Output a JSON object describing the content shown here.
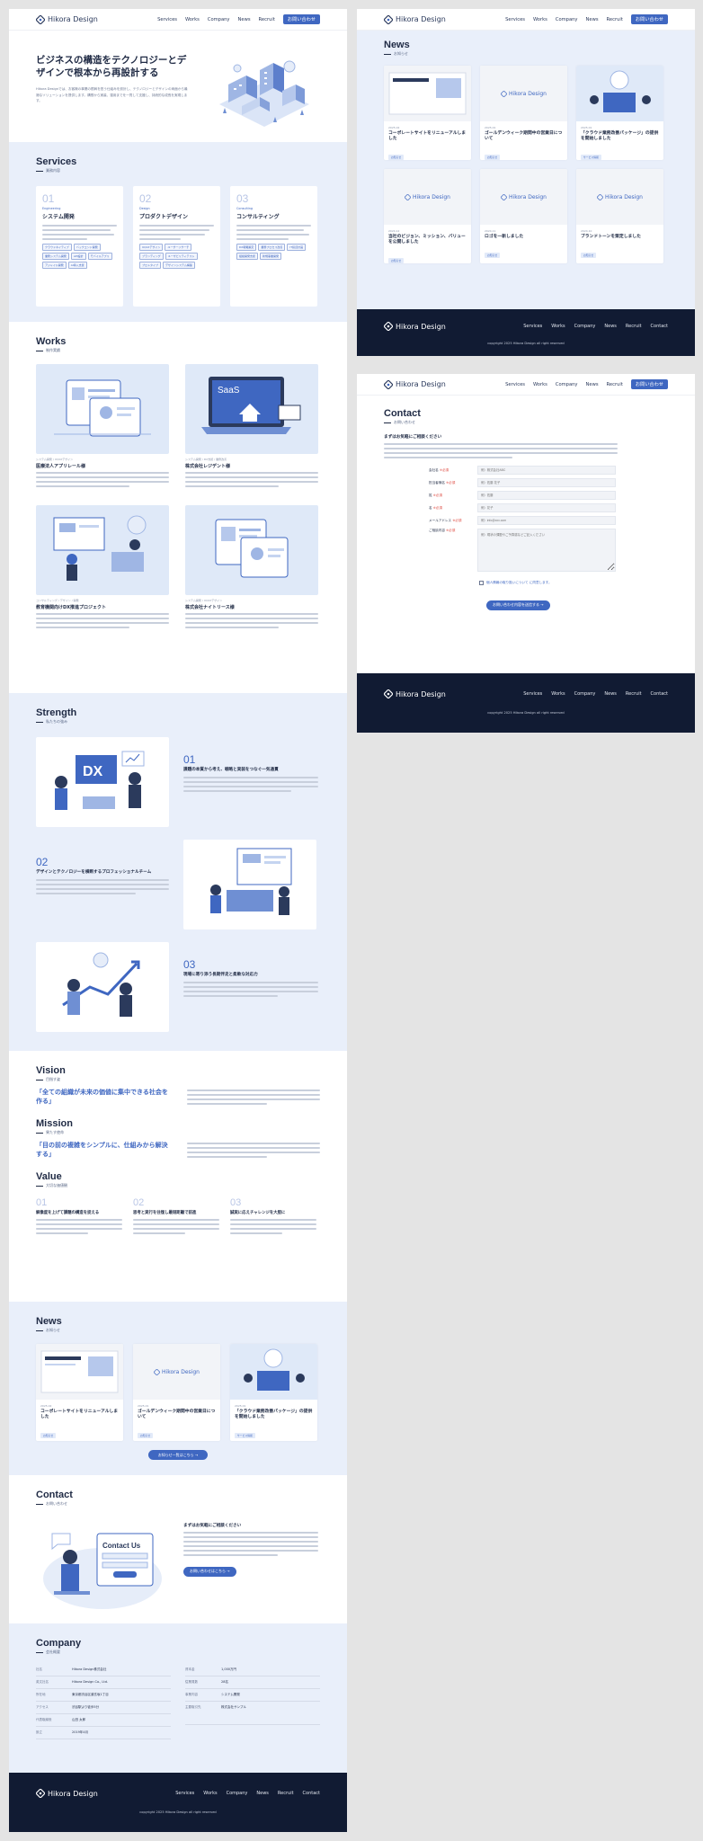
{
  "brand": {
    "name": "Hikora Design",
    "accent": "#3f67c1",
    "dark": "#111b33",
    "light_bg": "#e9effa"
  },
  "nav": {
    "items": [
      "Services",
      "Works",
      "Company",
      "News",
      "Recruit"
    ],
    "cta": "お問い合わせ",
    "footer_items": [
      "Services",
      "Works",
      "Company",
      "News",
      "Recruit",
      "Contact"
    ]
  },
  "hero": {
    "title": "ビジネスの構造をテクノロジーとデザインで根本から再設計する",
    "text": "Hikora Designでは、お客様の事業の根幹を担う仕組みを設計し、テクノロジーとデザインの両面から最適なソリューションを提供します。構想から実装、運用までを一貫して支援し、持続的な成長を実現します。"
  },
  "services": {
    "title": "Services",
    "sub": "業務内容",
    "items": [
      {
        "num": "01",
        "en": "Engineering",
        "title": "システム開発",
        "tags": [
          "クラウドネイティブ",
          "バックエンド開発",
          "業務システム開発",
          "API設計",
          "モバイルアプリ",
          "アジャイル開発",
          "AI導入支援"
        ]
      },
      {
        "num": "02",
        "en": "Design",
        "title": "プロダクトデザイン",
        "tags": [
          "UI/UXデザイン",
          "ユーザーリサーチ",
          "ブランディング",
          "ユーザビリティテスト",
          "プロトタイプ",
          "デザインシステム構築"
        ]
      },
      {
        "num": "03",
        "en": "Consulting",
        "title": "コンサルティング",
        "tags": [
          "DX戦略策定",
          "業務プロセス改善",
          "IT投資計画",
          "組織開発支援",
          "新規事業開発"
        ]
      }
    ]
  },
  "works": {
    "title": "Works",
    "sub": "制作実績",
    "items": [
      {
        "cat": "システム開発 / UI/UXデザイン",
        "title": "医療法人アプリレール様"
      },
      {
        "cat": "システム開発 / DX支援 / 業務改善",
        "title": "株式会社レジデント様"
      },
      {
        "cat": "コンサルティング / デザイン / 開発",
        "title": "教育機関向けDX推進プロジェクト"
      },
      {
        "cat": "システム開発 / UI/UXデザイン",
        "title": "株式会社ナイトリース様"
      }
    ]
  },
  "strength": {
    "title": "Strength",
    "sub": "私たちの強み",
    "items": [
      {
        "num": "01",
        "title": "課題の本質から考え、戦略と実装をつなぐ一気通貫",
        "img_label": "DX"
      },
      {
        "num": "02",
        "title": "デザインとテクノロジーを横断するプロフェッショナルチーム",
        "img_label": ""
      },
      {
        "num": "03",
        "title": "現場に寄り添う長期伴走と柔軟な対応力",
        "img_label": ""
      }
    ]
  },
  "vision": {
    "title": "Vision",
    "sub": "目指す姿",
    "quote": "「全ての組織が未来の価値に集中できる社会を作る」"
  },
  "mission": {
    "title": "Mission",
    "sub": "果たす使命",
    "quote": "「目の前の複雑をシンプルに、仕組みから解決する」"
  },
  "value": {
    "title": "Value",
    "sub": "大切な価値観",
    "items": [
      {
        "num": "01",
        "title": "解像度を上げて課題の構造を捉える"
      },
      {
        "num": "02",
        "title": "思考と実行を往復し最短距離で前進"
      },
      {
        "num": "03",
        "title": "誠実に応えチャレンジを大胆に"
      }
    ]
  },
  "news": {
    "title": "News",
    "sub": "お知らせ",
    "more": "お知らせ一覧はこちら →",
    "items": [
      {
        "date": "2025.02",
        "title": "コーポレートサイトをリニューアルしました",
        "tag": "お知らせ"
      },
      {
        "date": "2025.01",
        "title": "ゴールデンウィーク期間中の営業日について",
        "tag": "お知らせ"
      },
      {
        "date": "2025.01",
        "title": "「クラウド業務改善パッケージ」の提供を開始しました",
        "tag": "サービス情報"
      },
      {
        "date": "2024.12",
        "title": "当社のビジョン、ミッション、バリューを公開しました",
        "tag": "お知らせ"
      },
      {
        "date": "2024.11",
        "title": "ロゴを一新しました",
        "tag": "お知らせ"
      },
      {
        "date": "2024.10",
        "title": "ブランドトーンを策定しました",
        "tag": "お知らせ"
      }
    ]
  },
  "contact": {
    "title": "Contact",
    "sub": "お問い合わせ",
    "head": "まずはお気軽にご相談ください",
    "btn": "お問い合わせ内容を送信する →",
    "btn_home": "お問い合わせはこちら →",
    "illustration_label": "Contact Us",
    "form": [
      {
        "label": "会社名",
        "placeholder": "例）株式会社ABC"
      },
      {
        "label": "担当者様名",
        "placeholder": "例）佐藤 花子"
      },
      {
        "label": "姓",
        "placeholder": "例）佐藤"
      },
      {
        "label": "名",
        "placeholder": "例）花子"
      },
      {
        "label": "メールアドレス",
        "placeholder": "例）info@xxx.com"
      },
      {
        "label": "ご相談内容",
        "placeholder": "例）現状の課題やご予算感などご記入ください"
      }
    ],
    "required": "※必須",
    "privacy": "個人情報の取り扱いについて に同意します。"
  },
  "company": {
    "title": "Company",
    "sub": "会社概要",
    "left": [
      {
        "k": "社名",
        "v": "Hikora Design株式会社"
      },
      {
        "k": "英文社名",
        "v": "Hikora Design Co., Ltd."
      },
      {
        "k": "所在地",
        "v": "東京都渋谷区道玄坂1丁目"
      },
      {
        "k": "アクセス",
        "v": "渋谷駅より徒歩5分"
      },
      {
        "k": "代表取締役",
        "v": "山田 太郎"
      },
      {
        "k": "設立",
        "v": "2019年4月"
      }
    ],
    "right": [
      {
        "k": "資本金",
        "v": "1,000万円"
      },
      {
        "k": "従業員数",
        "v": "28名"
      },
      {
        "k": "事業内容",
        "v": "システム開発"
      },
      {
        "k": "主要取引先",
        "v": "株式会社サンプル"
      }
    ]
  },
  "copyright": "copyright 2025 Hikora Design all right reserved"
}
